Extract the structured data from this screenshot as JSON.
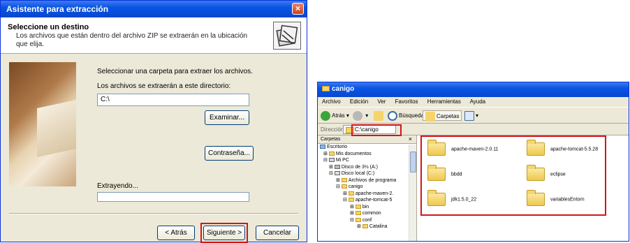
{
  "wizard": {
    "title": "Asistente para extracción",
    "close_glyph": "×",
    "header_title": "Seleccione un destino",
    "header_desc": "Los archivos que están dentro del archivo ZIP se extraerán en la ubicación que elija.",
    "select_label": "Seleccionar una carpeta para extraer los archivos.",
    "dir_label": "Los archivos se extraerán a este directorio:",
    "dir_value": "C:\\",
    "browse_button": "Examinar...",
    "password_button": "Contraseña...",
    "extracting_label": "Extrayendo...",
    "progress": 0,
    "back_button": "< Atrás",
    "next_button": "Siguiente >",
    "cancel_button": "Cancelar"
  },
  "explorer": {
    "title": "canigo",
    "menu": [
      "Archivo",
      "Edición",
      "Ver",
      "Favoritos",
      "Herramientas",
      "Ayuda"
    ],
    "toolbar": {
      "back": "Atrás",
      "search": "Búsqueda",
      "folders": "Carpetas"
    },
    "address_label": "Dirección",
    "address_value": "C:\\canigo",
    "folders_pane_title": "Carpetas",
    "folders_pane_close": "×",
    "tree": [
      "Escritorio",
      "Mis documentos",
      "Mi PC",
      "Disco de 3½ (A:)",
      "Disco local (C:)",
      "Archivos de programa",
      "canigo",
      "apache-maven-2.",
      "apache-tomcat-5",
      "bin",
      "common",
      "conf",
      "Catalina"
    ],
    "files": [
      "apache-maven-2.0.11",
      "apache-tomcat-5.5.28",
      "bbdd",
      "eclipse",
      "jdk1.5.0_22",
      "variablesEntorn"
    ]
  },
  "colors": {
    "highlight": "#d4141c",
    "titlebar": "#0a54e3",
    "window_bg": "#ece9d8"
  }
}
